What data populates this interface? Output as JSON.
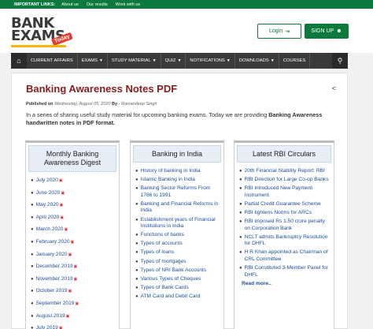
{
  "topbar": {
    "label": "IMPORTANT LINKS:",
    "links": [
      "About us",
      "Our results",
      "Work with us"
    ]
  },
  "logo": {
    "line1": "BANK",
    "line2": "EXAMS",
    "badge": "Today"
  },
  "header": {
    "login": "Login",
    "signup": "SIGN UP"
  },
  "nav": {
    "items": [
      "CURRENT AFFAIRS",
      "EXAMS",
      "STUDY MATERIAL",
      "QUIZ",
      "NOTIFICATIONS",
      "DOWNLOADS",
      "COURSES"
    ],
    "home_icon": "home-icon",
    "search_icon": "search-icon"
  },
  "post": {
    "title": "Banking Awareness Notes PDF",
    "meta_published": "Published on",
    "meta_date": "Wednesday, August 05, 2020",
    "meta_by": "By",
    "meta_author": "- Ramandeep Singh",
    "intro_plain": "In a series of sharing useful study material for upcoming banking exams. Today we are providing ",
    "intro_bold": "Banking Awareness handwritten notes in PDF format."
  },
  "col1": {
    "heading": "Monthly Banking Awareness Digest",
    "items": [
      "July 2020",
      "June 2020",
      "May 2020",
      "April 2020",
      "March 2020",
      "February 2020",
      "January 2020",
      "December 2019",
      "November 2019",
      "October 2019",
      "September 2019",
      "August 2019",
      "July 2019"
    ]
  },
  "col2": {
    "heading": "Banking in India",
    "items": [
      "History of banking in India",
      "Islamic Banking in India",
      "Banking Sector Reforms From 1786 to 1991",
      "Banking and Financial Reforms in India",
      "Establishment years of Financial Institutions in India",
      "Functions of banks",
      "Types of accounts",
      "Types of loans",
      "Types of mortgages",
      "Types of NRI Bank Accounts",
      "Various Types of Cheques",
      "Types of Bank Cards",
      "ATM Card and Debit Card"
    ]
  },
  "col3": {
    "heading": "Latest RBI Circulars",
    "items": [
      "20th Financial Stability Report: RBI",
      "RBI Direction for Large Co-op Banks",
      "RBI introduced New Payment Instrument",
      "Partial Credit Guarantee Scheme",
      "RBI tightens Norms for ARCs",
      "RBI imposed Rs 1.50 crore penalty on Corporation Bank",
      "NCLT admits Bankruptcy Resolution for DHFL",
      "H R Khan appointed as Chairman of CRL Committee",
      "RBI Constituted 3-Member Panel for DHFL"
    ],
    "readmore": "Read more.."
  }
}
